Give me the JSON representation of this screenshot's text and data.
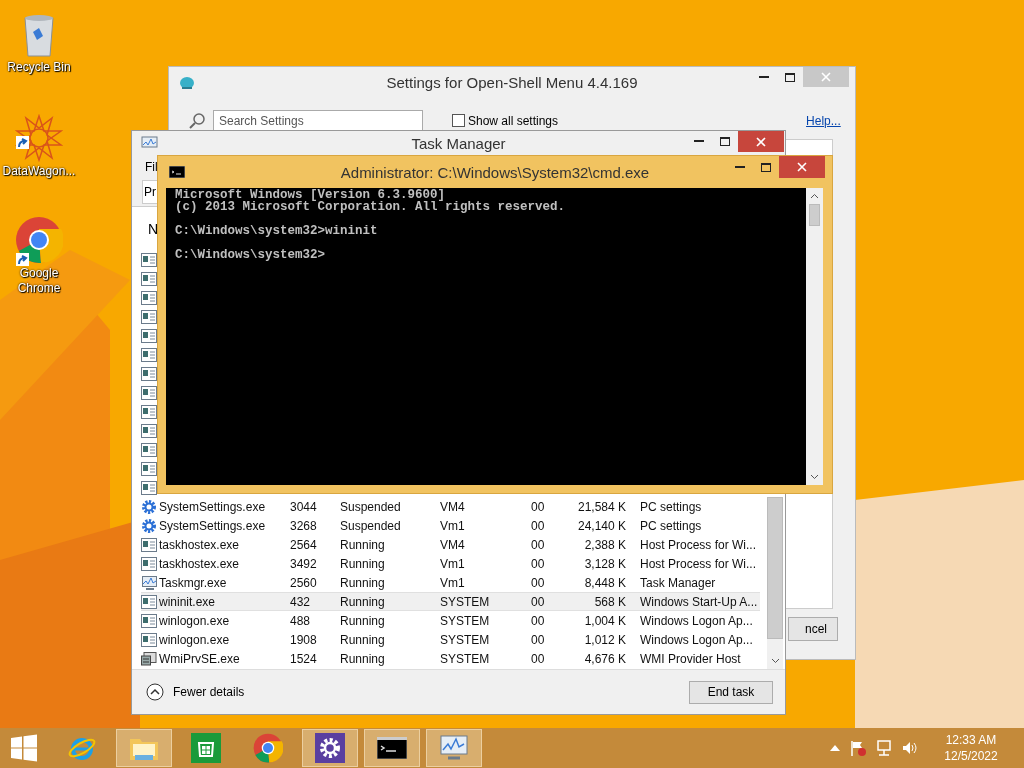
{
  "desktop_icons": [
    {
      "kind": "recycle",
      "label": "Recycle Bin",
      "shortcut": false
    },
    {
      "kind": "star",
      "label": "DataWagon...",
      "shortcut": true
    },
    {
      "kind": "chrome",
      "label": "Google Chrome",
      "shortcut": true
    }
  ],
  "settings_window": {
    "title": "Settings for Open-Shell Menu 4.4.169",
    "search": {
      "placeholder": "Search Settings"
    },
    "show_all": {
      "label": "Show all settings",
      "checked": false
    },
    "help_link": "Help...",
    "cancel_button": "ncel"
  },
  "task_manager": {
    "title": "Task Manager",
    "menu_fragment": "Fil",
    "tab_fragment": "Pr",
    "column_fragment": "N",
    "rows": [
      {
        "kind": "gear",
        "name": "SystemSettings.exe",
        "pid": "3044",
        "status": "Suspended",
        "user": "VM4",
        "cpu": "00",
        "memory": "21,584 K",
        "description": "PC settings",
        "selected": false
      },
      {
        "kind": "gear",
        "name": "SystemSettings.exe",
        "pid": "3268",
        "status": "Suspended",
        "user": "Vm1",
        "cpu": "00",
        "memory": "24,140 K",
        "description": "PC settings",
        "selected": false
      },
      {
        "kind": "app",
        "name": "taskhostex.exe",
        "pid": "2564",
        "status": "Running",
        "user": "VM4",
        "cpu": "00",
        "memory": "2,388 K",
        "description": "Host Process for Wi...",
        "selected": false
      },
      {
        "kind": "app",
        "name": "taskhostex.exe",
        "pid": "3492",
        "status": "Running",
        "user": "Vm1",
        "cpu": "00",
        "memory": "3,128 K",
        "description": "Host Process for Wi...",
        "selected": false
      },
      {
        "kind": "monitor",
        "name": "Taskmgr.exe",
        "pid": "2560",
        "status": "Running",
        "user": "Vm1",
        "cpu": "00",
        "memory": "8,448 K",
        "description": "Task Manager",
        "selected": false
      },
      {
        "kind": "app",
        "name": "wininit.exe",
        "pid": "432",
        "status": "Running",
        "user": "SYSTEM",
        "cpu": "00",
        "memory": "568 K",
        "description": "Windows Start-Up A...",
        "selected": true
      },
      {
        "kind": "app",
        "name": "winlogon.exe",
        "pid": "488",
        "status": "Running",
        "user": "SYSTEM",
        "cpu": "00",
        "memory": "1,004 K",
        "description": "Windows Logon Ap...",
        "selected": false
      },
      {
        "kind": "app",
        "name": "winlogon.exe",
        "pid": "1908",
        "status": "Running",
        "user": "SYSTEM",
        "cpu": "00",
        "memory": "1,012 K",
        "description": "Windows Logon Ap...",
        "selected": false
      },
      {
        "kind": "wmi",
        "name": "WmiPrvSE.exe",
        "pid": "1524",
        "status": "Running",
        "user": "SYSTEM",
        "cpu": "00",
        "memory": "4,676 K",
        "description": "WMI Provider Host",
        "selected": false
      }
    ],
    "fewer_details": "Fewer details",
    "end_task": "End task"
  },
  "cmd": {
    "title": "Administrator: C:\\Windows\\System32\\cmd.exe",
    "blocks": [
      [
        "Microsoft Windows [Version 6.3.9600]",
        "(c) 2013 Microsoft Corporation. All rights reserved."
      ],
      [
        "C:\\Windows\\system32>wininit"
      ],
      [
        "C:\\Windows\\system32>"
      ]
    ]
  },
  "taskbar": {
    "apps": [
      {
        "kind": "ie",
        "running": false
      },
      {
        "kind": "explorer",
        "running": true
      },
      {
        "kind": "store",
        "running": false
      },
      {
        "kind": "chrome",
        "running": false
      },
      {
        "kind": "settings",
        "running": true
      },
      {
        "kind": "cmd",
        "running": true
      },
      {
        "kind": "taskmgr",
        "running": true
      }
    ],
    "clock": {
      "time": "12:33 AM",
      "date": "12/5/2022"
    }
  }
}
